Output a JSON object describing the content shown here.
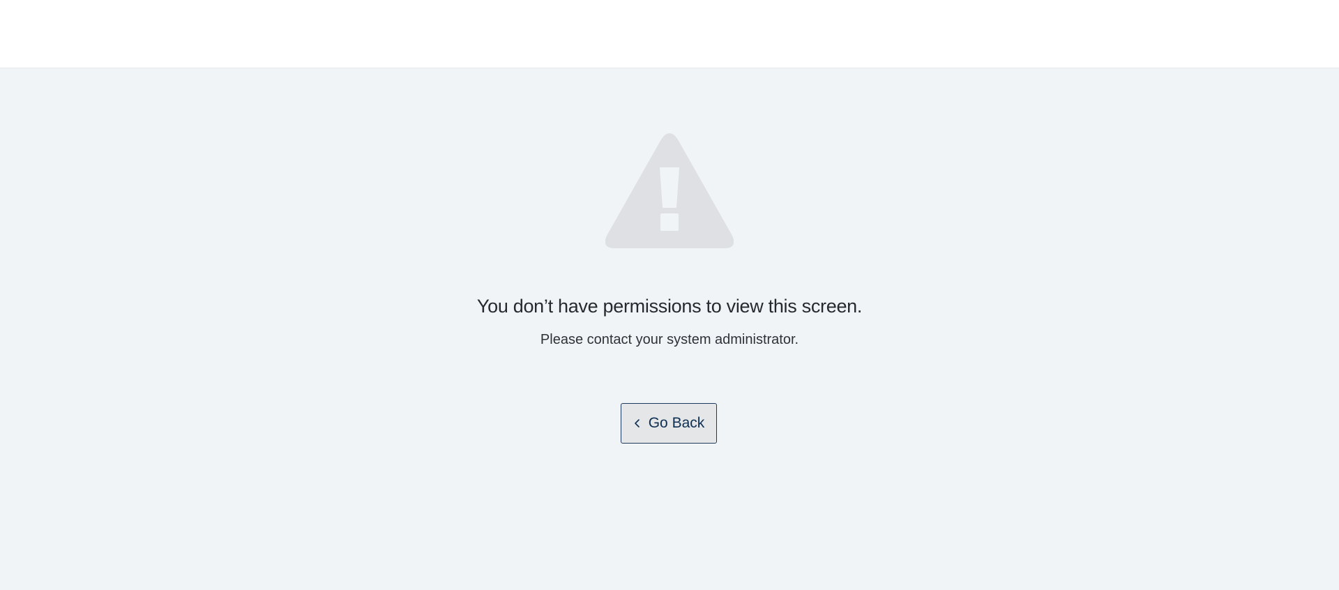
{
  "header": {},
  "error": {
    "icon": "warning-triangle-icon",
    "title": "You don’t have permissions to view this screen.",
    "message": "Please contact your system administrator."
  },
  "actions": {
    "back_label": "Go Back",
    "back_icon": "chevron-left-icon"
  },
  "colors": {
    "page_background": "#f1f4f7",
    "header_background": "#ffffff",
    "icon_color": "#dee0e3",
    "button_background": "#e4e6e8",
    "button_border": "#1d3a5c",
    "button_text": "#0f2f52"
  }
}
